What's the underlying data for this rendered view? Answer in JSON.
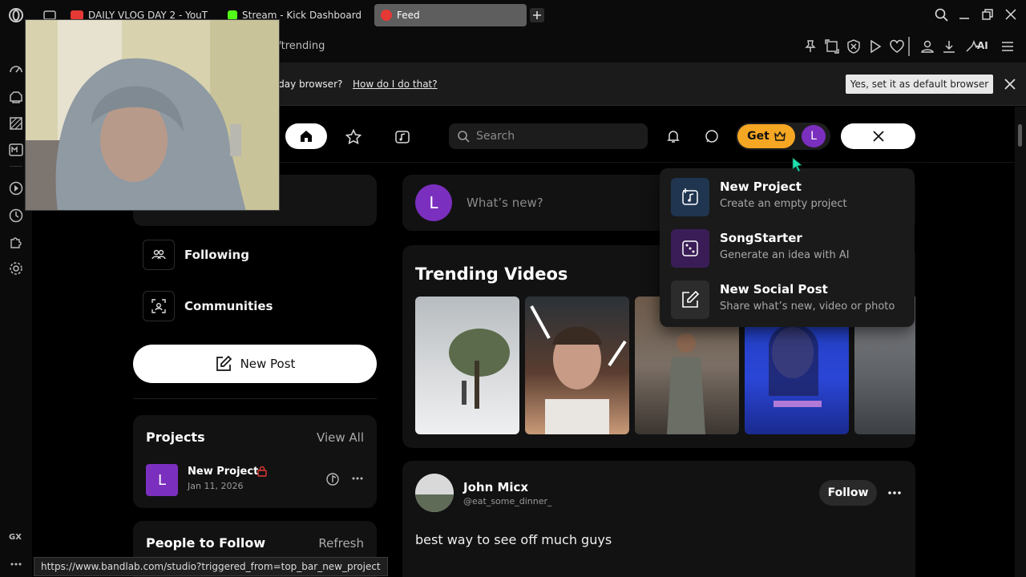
{
  "browser": {
    "tabs": [
      {
        "label": "DAILY VLOG DAY 2 - YouT",
        "color": "#e53935"
      },
      {
        "label": "Stream - Kick Dashboard",
        "color": "#53fc18"
      },
      {
        "label": "Feed",
        "color": "#e53935"
      }
    ],
    "url": "ed/trending",
    "ai_label": "AI",
    "infobar": {
      "question": "yday browser?",
      "link": "How do I do that?",
      "default_button": "Yes, set it as default browser"
    },
    "status_url": "https://www.bandlab.com/studio?triggered_from=top_bar_new_project",
    "gx_label": "GX"
  },
  "topnav": {
    "search_placeholder": "Search",
    "get_label": "Get",
    "avatar_letter": "L"
  },
  "left_nav": {
    "following": "Following",
    "communities": "Communities",
    "new_post": "New Post"
  },
  "projects": {
    "title": "Projects",
    "view_all": "View All",
    "item": {
      "letter": "L",
      "name": "New Project",
      "date": "Jan 11, 2026"
    }
  },
  "people": {
    "title": "People to Follow",
    "refresh": "Refresh"
  },
  "whats_new": {
    "avatar_letter": "L",
    "placeholder": "What’s new?"
  },
  "trending": {
    "title": "Trending Videos"
  },
  "post": {
    "name": "John Micx",
    "handle": "@eat_some_dinner_",
    "follow": "Follow",
    "text": "best way to see off much guys"
  },
  "create_menu": [
    {
      "title": "New Project",
      "desc": "Create an empty project",
      "icon": "music-plus-icon"
    },
    {
      "title": "SongStarter",
      "desc": "Generate an idea with AI",
      "icon": "dice-icon"
    },
    {
      "title": "New Social Post",
      "desc": "Share what’s new, video or photo",
      "icon": "edit-icon"
    }
  ],
  "colors": {
    "accent_purple": "#7b2fbe",
    "get_orange": "#f5a623",
    "lock_red": "#e53935"
  }
}
